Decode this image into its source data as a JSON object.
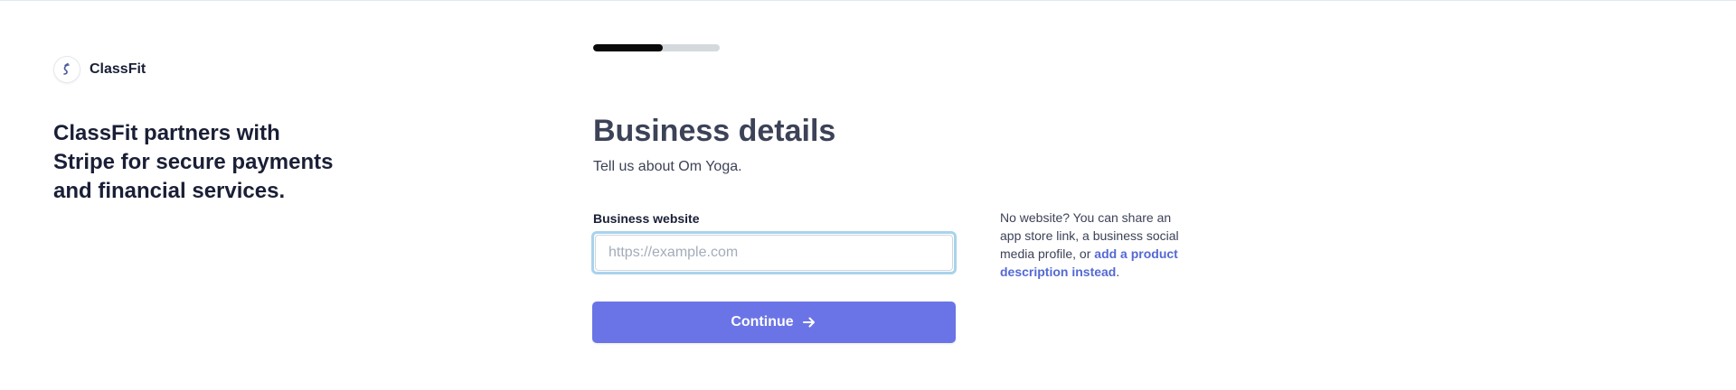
{
  "brand": {
    "name": "ClassFit",
    "logo_icon": "classfit-logo-icon"
  },
  "left_panel": {
    "partner_text": "ClassFit partners with Stripe for secure payments and financial services."
  },
  "progress": {
    "fraction": 0.55
  },
  "form": {
    "title": "Business details",
    "subtitle": "Tell us about Om Yoga.",
    "website_label": "Business website",
    "website_placeholder": "https://example.com",
    "website_value": "",
    "continue_label": "Continue",
    "continue_icon": "arrow-right-icon"
  },
  "help": {
    "text_prefix": "No website? You can share an app store link, a business social media profile, or ",
    "link_text": "add a product description instead",
    "text_suffix": "."
  },
  "colors": {
    "accent": "#6a74e6",
    "link": "#5469d4",
    "focus_ring": "#a9d3ec",
    "progress_fill": "#0a0a0a",
    "progress_track": "#d5d9de"
  }
}
